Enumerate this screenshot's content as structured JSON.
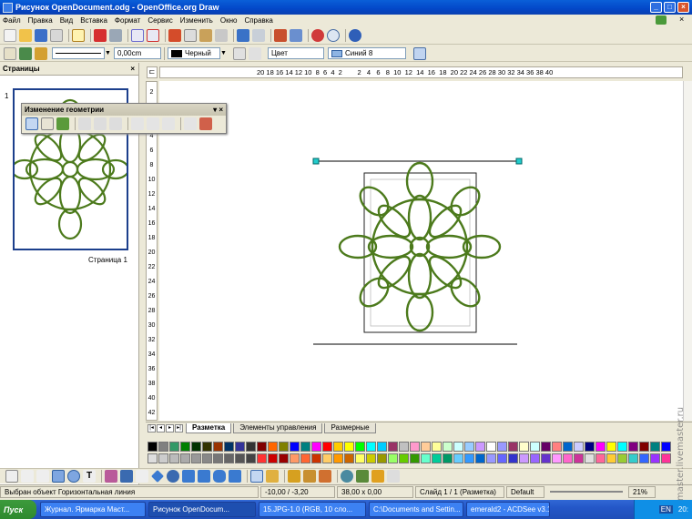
{
  "window": {
    "title": "Рисунок OpenDocument.odg - OpenOffice.org Draw"
  },
  "menu": [
    "Файл",
    "Правка",
    "Вид",
    "Вставка",
    "Формат",
    "Сервис",
    "Изменить",
    "Окно",
    "Справка"
  ],
  "line_toolbar": {
    "line_width": "0,00cm",
    "line_color": "Черный",
    "area_style": "Цвет",
    "area_color": "Синий 8"
  },
  "pages_panel": {
    "title": "Страницы",
    "page_number": "1",
    "page_label": "Страница 1"
  },
  "geometry_toolbar": {
    "title": "Изменение геометрии"
  },
  "ruler": {
    "horizontal": "20 18 16 14 12 10  8  6  4  2        2   4   6   8  10  12  14  16  18  20 22 24 26 28 30 32 34 36 38 40",
    "vertical": [
      "2",
      "0",
      "2",
      "4",
      "6",
      "8",
      "10",
      "12",
      "14",
      "16",
      "18",
      "20",
      "22",
      "24",
      "26",
      "28",
      "30",
      "32",
      "34",
      "36",
      "38",
      "40",
      "42"
    ]
  },
  "tabs": [
    "Разметка",
    "Элементы управления",
    "Размерные"
  ],
  "status": {
    "selection": "Выбран объект Горизонтальная линия",
    "position": "-10,00 / -3,20",
    "size": "38,00 x 0,00",
    "slide": "Слайд 1 / 1 (Разметка)",
    "style": "Default",
    "zoom": "21%"
  },
  "taskbar": {
    "start": "Пуск",
    "tasks": [
      "Журнал. Ярмарка Маст...",
      "Рисунок OpenDocum...",
      "15.JPG-1.0 (RGB, 10 сло...",
      "C:\\Documents and Settin...",
      "emerald2 - ACDSee v3.1"
    ],
    "lang": "EN",
    "clock": "20:"
  },
  "watermark": "master.livemaster.ru",
  "palette_colors": [
    "#000000",
    "#808080",
    "#339966",
    "#008000",
    "#003300",
    "#333300",
    "#993300",
    "#003366",
    "#333399",
    "#333333",
    "#800000",
    "#ff6600",
    "#808000",
    "#0000ff",
    "#008080",
    "#ff00ff",
    "#ff0000",
    "#ffcc00",
    "#ffff00",
    "#00ff00",
    "#00ffff",
    "#00ccff",
    "#993366",
    "#c0c0c0",
    "#ff99cc",
    "#ffcc99",
    "#ffff99",
    "#ccffcc",
    "#ccffff",
    "#99ccff",
    "#cc99ff",
    "#ffffff",
    "#9999ff",
    "#993366",
    "#ffffcc",
    "#ccffff",
    "#660066",
    "#ff8080",
    "#0066cc",
    "#ccccff",
    "#000080",
    "#ff00ff",
    "#ffff00",
    "#00ffff",
    "#800080",
    "#800000",
    "#008080",
    "#0000ff",
    "#00ccff",
    "#ccffff",
    "#dddddd",
    "#cccccc",
    "#bbbbbb",
    "#aaaaaa",
    "#999999",
    "#888888",
    "#777777",
    "#666666",
    "#555555",
    "#444444",
    "#ff3333",
    "#cc0000",
    "#990000",
    "#ff9966",
    "#ff6633",
    "#cc3300",
    "#ffcc66",
    "#ff9900",
    "#cc6600",
    "#ffff66",
    "#cccc00",
    "#999900",
    "#99ff66",
    "#66cc00",
    "#339900",
    "#66ffcc",
    "#00cc99",
    "#009966",
    "#66ccff",
    "#3399ff",
    "#0066cc",
    "#9999ff",
    "#6666ff",
    "#3333cc",
    "#cc99ff",
    "#9966ff",
    "#6633cc",
    "#ff99ff",
    "#ff66cc",
    "#cc3399",
    "#e0e0e0",
    "#ff6699",
    "#ffcc33",
    "#99cc33",
    "#33cccc",
    "#3366ff",
    "#9933ff",
    "#ff3399",
    "#66ff66"
  ]
}
